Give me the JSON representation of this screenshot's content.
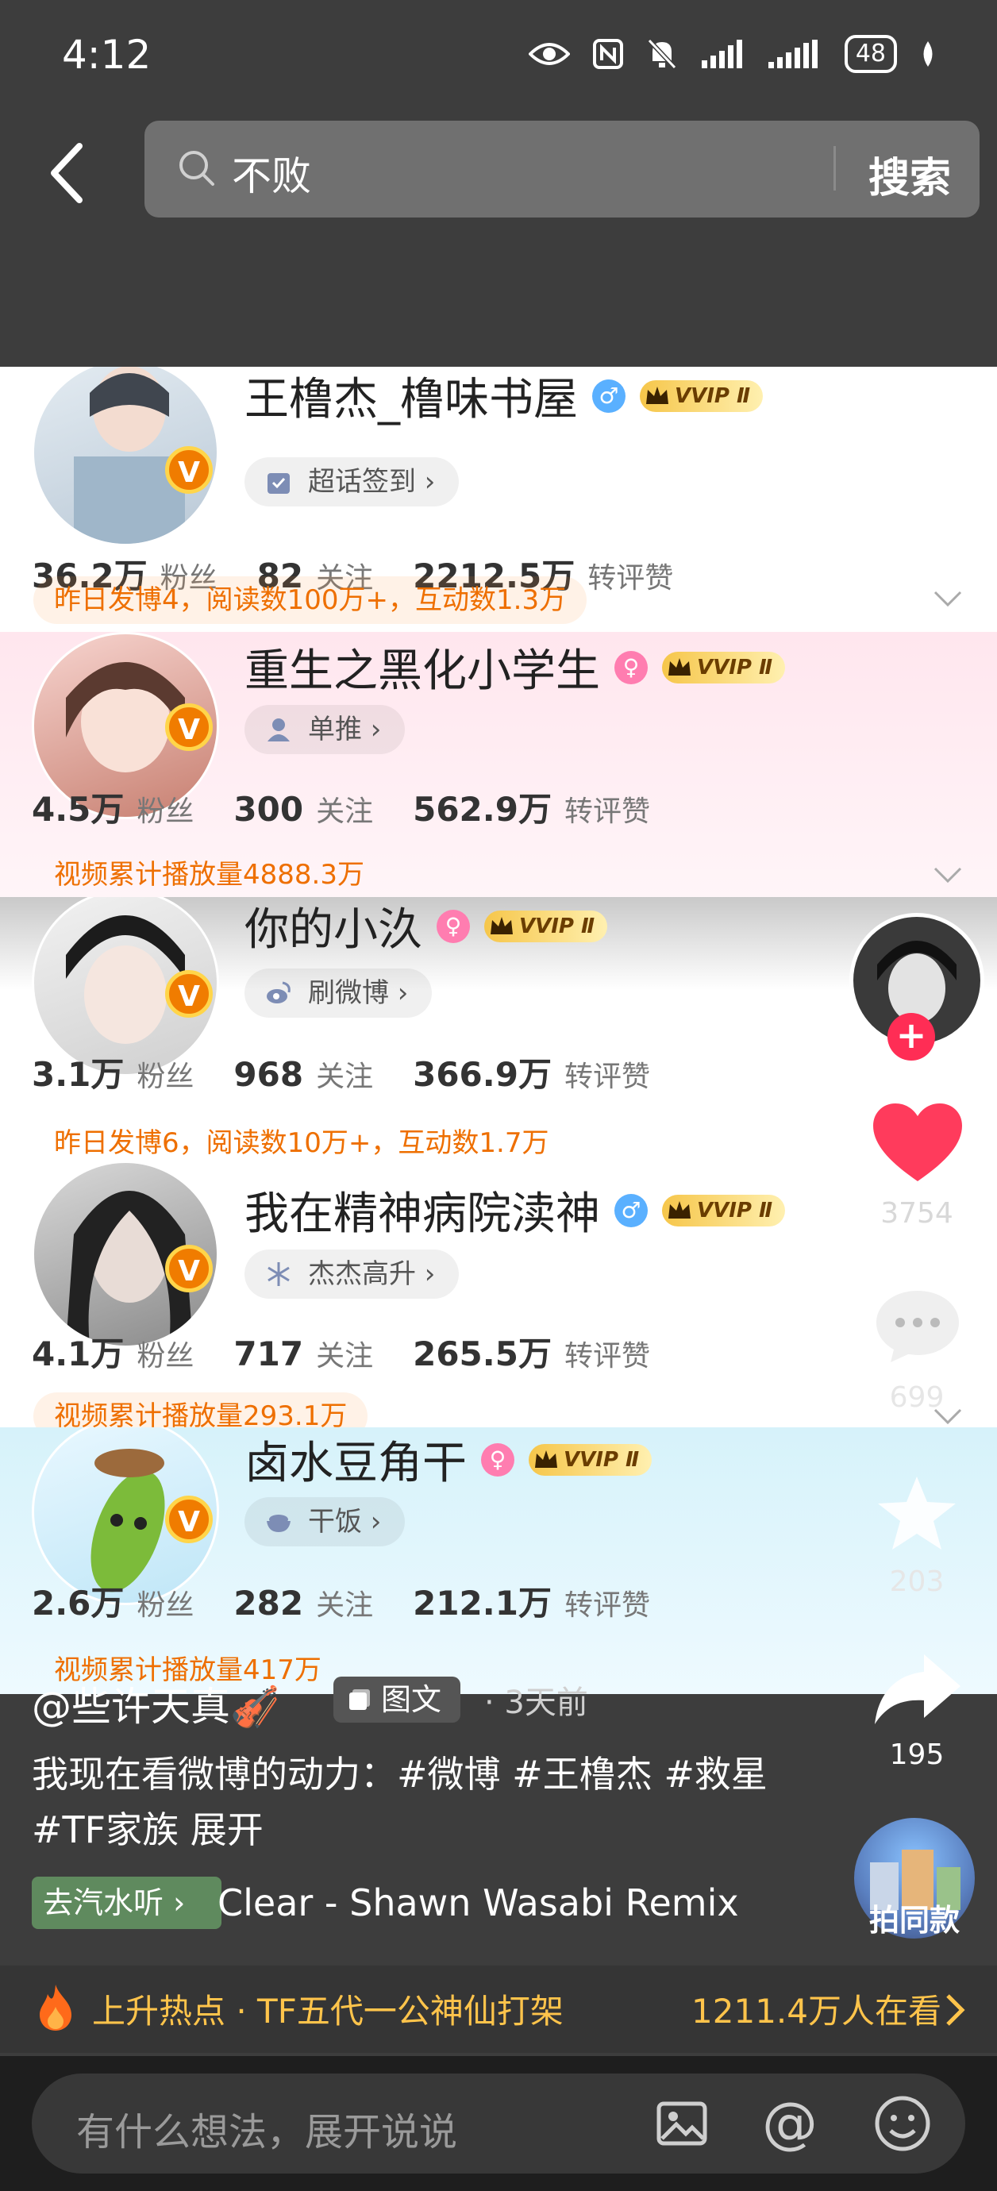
{
  "status_bar": {
    "time": "4:12",
    "battery": "48"
  },
  "search": {
    "query": "不败",
    "button_label": "搜索"
  },
  "cards": [
    {
      "name": "王橹杰_橹味书屋",
      "gender": "♂",
      "vip": "VVIP Ⅱ",
      "tag": "超话签到",
      "fans": "36.2万",
      "fans_label": "粉丝",
      "follow": "82",
      "follow_label": "关注",
      "interact": "2212.5万",
      "interact_label": "转评赞",
      "summary": "昨日发博4，阅读数100万+，互动数1.3万"
    },
    {
      "name": "重生之黑化小学生",
      "gender": "♀",
      "vip": "VVIP Ⅱ",
      "tag": "单推",
      "fans": "4.5万",
      "fans_label": "粉丝",
      "follow": "300",
      "follow_label": "关注",
      "interact": "562.9万",
      "interact_label": "转评赞",
      "summary": "视频累计播放量4888.3万"
    },
    {
      "name": "你的小汣",
      "gender": "♀",
      "vip": "VVIP Ⅱ",
      "tag": "刷微博",
      "fans": "3.1万",
      "fans_label": "粉丝",
      "follow": "968",
      "follow_label": "关注",
      "interact": "366.9万",
      "interact_label": "转评赞",
      "summary": "昨日发博6，阅读数10万+，互动数1.7万"
    },
    {
      "name": "我在精神病院渎神",
      "gender": "♂",
      "vip": "VVIP Ⅱ",
      "tag": "杰杰高升",
      "fans": "4.1万",
      "fans_label": "粉丝",
      "follow": "717",
      "follow_label": "关注",
      "interact": "265.5万",
      "interact_label": "转评赞",
      "summary": "视频累计播放量293.1万"
    },
    {
      "name": "卤水豆角干",
      "gender": "♀",
      "vip": "VVIP Ⅱ",
      "tag": "干饭",
      "fans": "2.6万",
      "fans_label": "粉丝",
      "follow": "282",
      "follow_label": "关注",
      "interact": "212.1万",
      "interact_label": "转评赞",
      "summary": "视频累计播放量417万"
    }
  ],
  "actions": {
    "likes": "3754",
    "comments": "699",
    "favorites": "203",
    "shares": "195",
    "same_style": "拍同款",
    "follow_plus": "+"
  },
  "post": {
    "author": "@些许天真🎻",
    "type_label": "图文",
    "time": "· 3天前",
    "caption": "我现在看微博的动力：#微博 #王橹杰 #救星 #TF家族 展开",
    "music_tag": "去汽水听",
    "music_title": "Clear - Shawn Wasabi Remix"
  },
  "hot": {
    "topic": "上升热点 · TF五代一公神仙打架",
    "viewers": "1211.4万人在看"
  },
  "comment": {
    "placeholder": "有什么想法，展开说说",
    "at_symbol": "@"
  },
  "colors": {
    "accent_orange": "#ee6f00",
    "hot_yellow": "#ffc44b",
    "like_red": "#ff3b5c",
    "follow_red": "#ff2d55"
  },
  "icons": [
    "eye-icon",
    "nfc-icon",
    "mute-bell-icon",
    "signal-icon",
    "signal-2-icon",
    "battery-icon",
    "leaf-icon",
    "back-arrow-icon",
    "search-icon",
    "heart-icon",
    "comment-icon",
    "star-icon",
    "share-icon",
    "fire-icon",
    "image-icon",
    "emoji-icon"
  ]
}
